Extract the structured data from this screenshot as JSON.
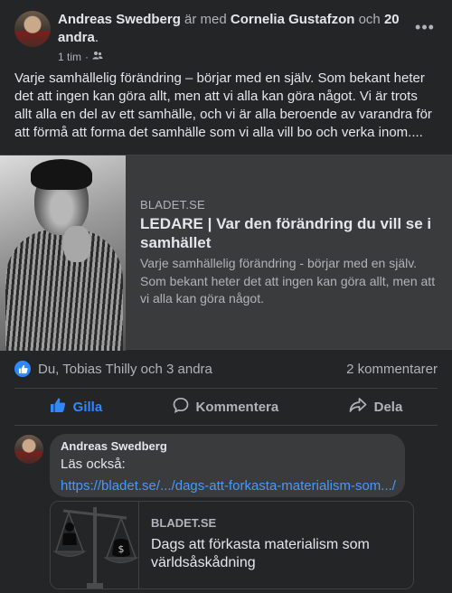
{
  "post": {
    "author": "Andreas Swedberg",
    "with_word": "är med",
    "tagged": "Cornelia Gustafzon",
    "and_word": "och",
    "others": "20 andra",
    "period": ".",
    "time": "1 tim",
    "dot": "·",
    "audience_icon": "friends-icon",
    "more_label": "•••",
    "text": "Varje samhällelig förändring – börjar med en själv. Som bekant heter det att ingen kan göra allt, men att vi alla kan göra något. Vi är trots allt alla en del av ett samhälle, och vi är alla beroende av varandra för att förmå att forma det samhälle som vi alla vill bo och verka inom...."
  },
  "link": {
    "source": "BLADET.SE",
    "title": "LEDARE | Var den förändring du vill se i samhället",
    "description": "Varje samhällelig förändring - börjar med en själv. Som bekant heter det att ingen kan göra allt, men att vi alla kan göra något."
  },
  "reactions": {
    "names": "Du, Tobias Thilly och 3 andra",
    "comments": "2 kommentarer"
  },
  "actions": {
    "like": "Gilla",
    "comment": "Kommentera",
    "share": "Dela"
  },
  "comment": {
    "author": "Andreas Swedberg",
    "text": "Läs också:",
    "link": "https://bladet.se/.../dags-att-forkasta-materialism-som.../",
    "card_source": "BLADET.SE",
    "card_title": "Dags att förkasta materialism som världsåskådning"
  },
  "colors": {
    "background": "#242526",
    "surface": "#3a3b3c",
    "accent": "#2e89ff",
    "link": "#4599ff"
  }
}
